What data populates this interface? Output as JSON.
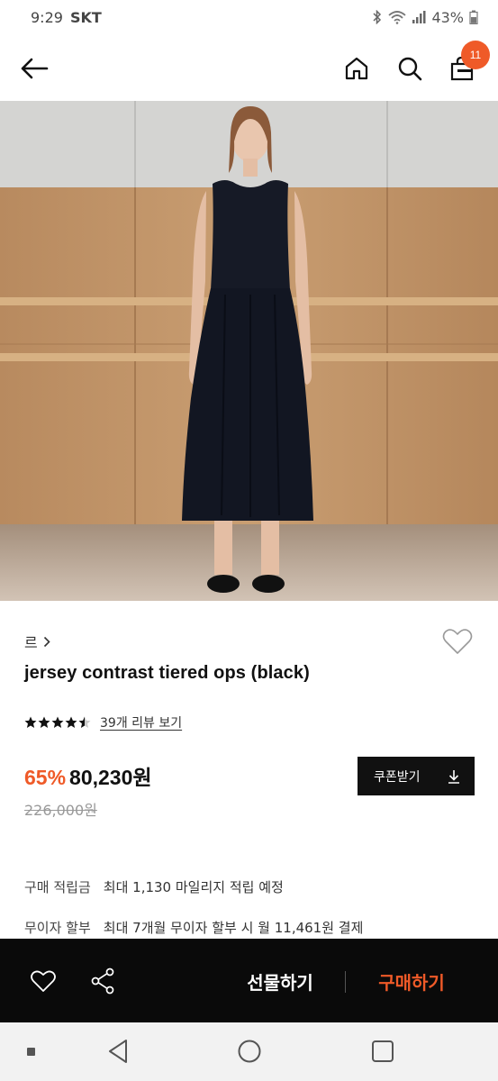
{
  "status_bar": {
    "time": "9:29",
    "carrier": "SKT",
    "battery": "43%"
  },
  "header": {
    "cart_count": "11",
    "icons": [
      "back-arrow-icon",
      "home-icon",
      "search-icon",
      "shopping-bag-icon"
    ]
  },
  "product": {
    "brand": "르",
    "title": "jersey contrast tiered ops (black)",
    "rating": 4.5,
    "review_link": "39개 리뷰 보기",
    "discount": "65%",
    "price": "80,230원",
    "original_price": "226,000원",
    "coupon_label": "쿠폰받기"
  },
  "info": {
    "points_key": "구매 적립금",
    "points_value": "최대 1,130 마일리지 적립 예정",
    "installment_key": "무이자 할부",
    "installment_value": "최대 7개월 무이자 할부 시 월 11,461원 결제"
  },
  "actions": {
    "gift_label": "선물하기",
    "buy_label": "구매하기"
  },
  "colors": {
    "accent": "#ef5a28",
    "action_bar": "#0a0a0a"
  }
}
